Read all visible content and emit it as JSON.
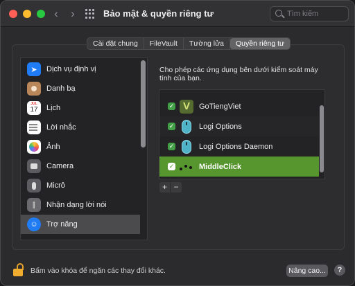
{
  "window": {
    "title": "Bảo mật & quyền riêng tư"
  },
  "search": {
    "placeholder": "Tìm kiếm"
  },
  "tabs": [
    {
      "label": "Cài đặt chung",
      "active": false
    },
    {
      "label": "FileVault",
      "active": false
    },
    {
      "label": "Tường lửa",
      "active": false
    },
    {
      "label": "Quyền riêng tư",
      "active": true
    }
  ],
  "sidebar": {
    "items": [
      {
        "label": "Dịch vụ định vị",
        "icon": "location-icon"
      },
      {
        "label": "Danh bạ",
        "icon": "contacts-icon"
      },
      {
        "label": "Lịch",
        "icon": "calendar-icon",
        "cal_month": "JUL",
        "cal_day": "17"
      },
      {
        "label": "Lời nhắc",
        "icon": "reminders-icon"
      },
      {
        "label": "Ảnh",
        "icon": "photos-icon"
      },
      {
        "label": "Camera",
        "icon": "camera-icon"
      },
      {
        "label": "Micrô",
        "icon": "microphone-icon"
      },
      {
        "label": "Nhận dạng lời nói",
        "icon": "speech-recognition-icon"
      },
      {
        "label": "Trợ năng",
        "icon": "accessibility-icon",
        "selected": true
      }
    ]
  },
  "main": {
    "description": "Cho phép các ứng dụng bên dưới kiểm soát máy tính của bạn.",
    "apps": [
      {
        "name": "GoTiengViet",
        "checked": true,
        "icon": "gotiengviet-icon"
      },
      {
        "name": "Logi Options",
        "checked": true,
        "icon": "logi-mouse-icon"
      },
      {
        "name": "Logi Options Daemon",
        "checked": true,
        "icon": "logi-mouse-icon"
      },
      {
        "name": "MiddleClick",
        "checked": true,
        "icon": "middleclick-icon",
        "selected": true
      }
    ],
    "add_label": "+",
    "remove_label": "−"
  },
  "footer": {
    "lock_text": "Bấm vào khóa để ngăn các thay đổi khác.",
    "advanced_label": "Nâng cao...",
    "help_label": "?"
  },
  "colors": {
    "selected_row": "#57962f",
    "checkbox": "#44a048",
    "accent_blue": "#1f7cf5",
    "lock": "#f0ad2e"
  }
}
